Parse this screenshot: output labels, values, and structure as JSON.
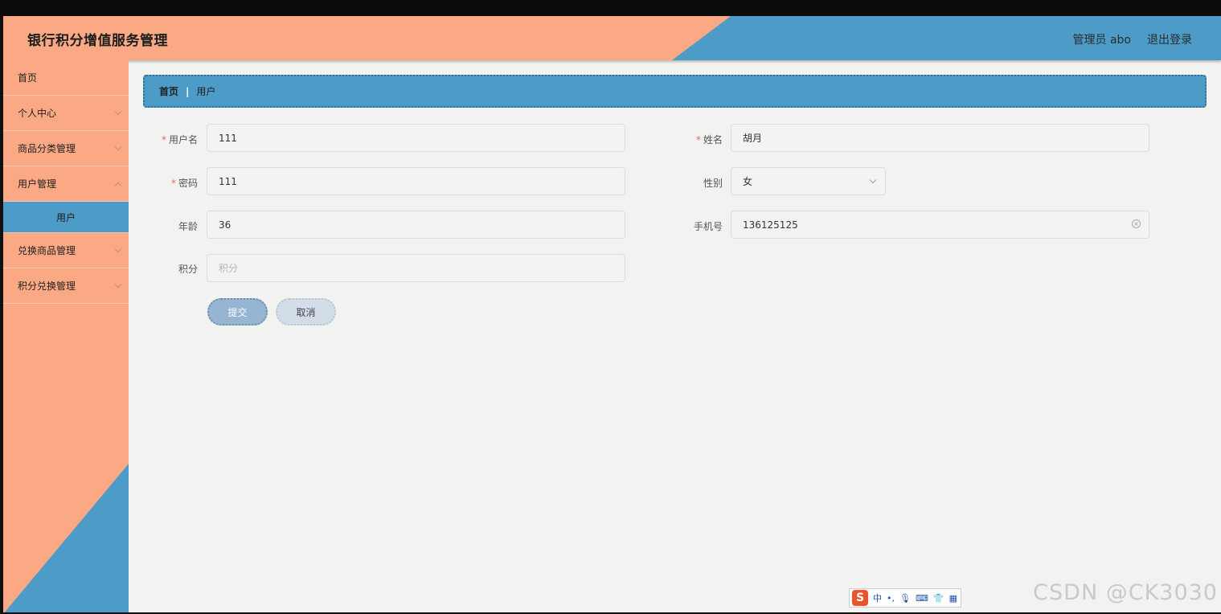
{
  "header": {
    "title": "银行积分增值服务管理",
    "user_label": "管理员 abo",
    "logout_label": "退出登录"
  },
  "colors": {
    "orange": "#fba985",
    "blue": "#4c9cc7",
    "content_bg": "#f2f2f1"
  },
  "sidebar": {
    "items": [
      {
        "label": "首页"
      },
      {
        "label": "个人中心"
      },
      {
        "label": "商品分类管理"
      },
      {
        "label": "用户管理"
      },
      {
        "label": "用户"
      },
      {
        "label": "兑换商品管理"
      },
      {
        "label": "积分兑换管理"
      }
    ]
  },
  "breadcrumb": {
    "home": "首页",
    "separator": "|",
    "current": "用户"
  },
  "form": {
    "username": {
      "label": "用户名",
      "value": "111"
    },
    "name": {
      "label": "姓名",
      "value": "胡月"
    },
    "password": {
      "label": "密码",
      "value": "111"
    },
    "gender": {
      "label": "性别",
      "value": "女"
    },
    "age": {
      "label": "年龄",
      "value": "36"
    },
    "phone": {
      "label": "手机号",
      "value": "136125125"
    },
    "points": {
      "label": "积分",
      "placeholder": "积分"
    },
    "submit_label": "提交",
    "cancel_label": "取消"
  },
  "ime": {
    "logo": "S",
    "mode": "中",
    "punct": "•,"
  },
  "watermark": "CSDN @CK3030"
}
